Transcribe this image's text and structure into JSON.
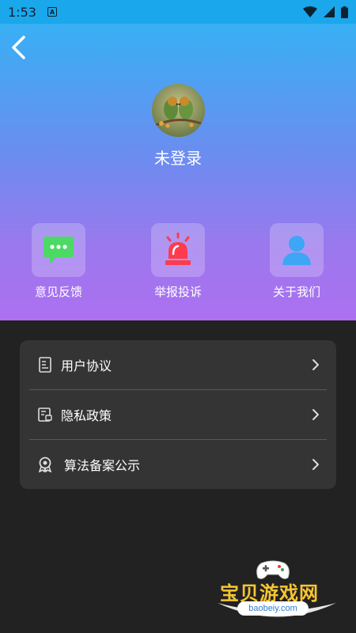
{
  "status_bar": {
    "time": "1:53",
    "notification_icon": "a-icon",
    "icons": [
      "wifi-icon",
      "signal-icon",
      "battery-icon"
    ]
  },
  "header": {
    "back_icon": "chevron-left-icon"
  },
  "profile": {
    "username": "未登录",
    "avatar_icon": "birds-photo-avatar"
  },
  "quick_actions": [
    {
      "label": "意见反馈",
      "icon": "chat-bubble-icon"
    },
    {
      "label": "举报投诉",
      "icon": "alarm-siren-icon"
    },
    {
      "label": "关于我们",
      "icon": "person-icon"
    }
  ],
  "menu": [
    {
      "label": "用户协议",
      "icon": "document-icon"
    },
    {
      "label": "隐私政策",
      "icon": "privacy-document-icon"
    },
    {
      "label": "算法备案公示",
      "icon": "award-badge-icon"
    }
  ],
  "watermark": {
    "title": "宝贝游戏网",
    "url": "baobeiy.com"
  },
  "colors": {
    "gradient_top": "#38b0f4",
    "gradient_bottom": "#ac70f0",
    "background": "#222222",
    "card": "#343434",
    "chat_green": "#4cd964",
    "siren_red": "#ff3b4e",
    "person_blue": "#3da6f5"
  }
}
